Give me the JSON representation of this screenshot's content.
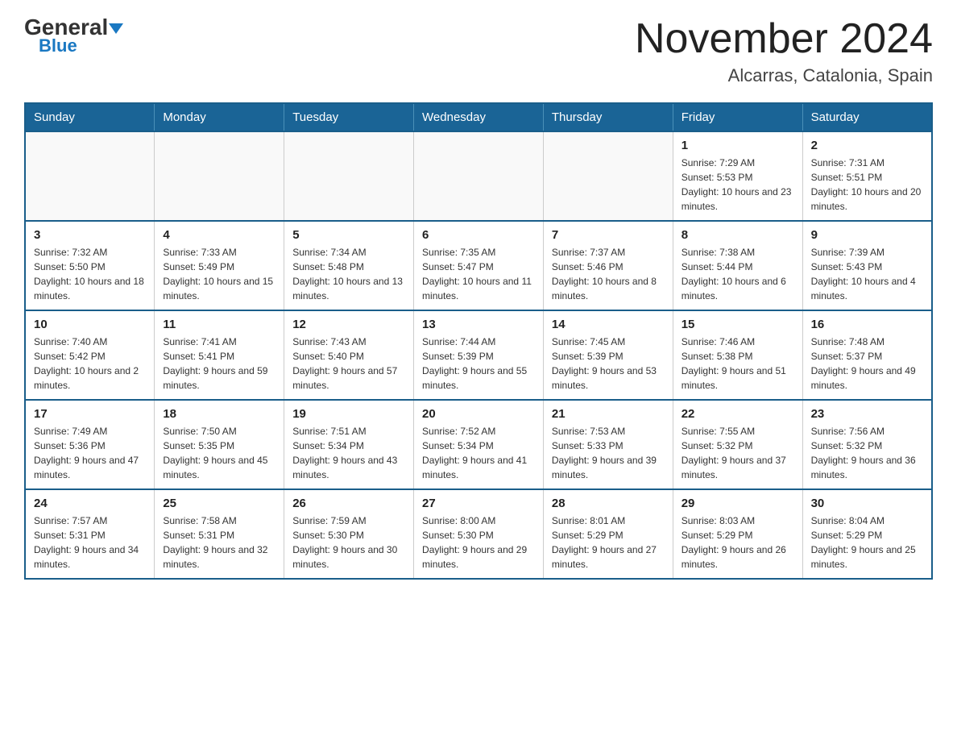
{
  "header": {
    "logo_general": "General",
    "logo_blue": "Blue",
    "month_title": "November 2024",
    "location": "Alcarras, Catalonia, Spain"
  },
  "weekdays": [
    "Sunday",
    "Monday",
    "Tuesday",
    "Wednesday",
    "Thursday",
    "Friday",
    "Saturday"
  ],
  "weeks": [
    [
      {
        "day": "",
        "sunrise": "",
        "sunset": "",
        "daylight": ""
      },
      {
        "day": "",
        "sunrise": "",
        "sunset": "",
        "daylight": ""
      },
      {
        "day": "",
        "sunrise": "",
        "sunset": "",
        "daylight": ""
      },
      {
        "day": "",
        "sunrise": "",
        "sunset": "",
        "daylight": ""
      },
      {
        "day": "",
        "sunrise": "",
        "sunset": "",
        "daylight": ""
      },
      {
        "day": "1",
        "sunrise": "Sunrise: 7:29 AM",
        "sunset": "Sunset: 5:53 PM",
        "daylight": "Daylight: 10 hours and 23 minutes."
      },
      {
        "day": "2",
        "sunrise": "Sunrise: 7:31 AM",
        "sunset": "Sunset: 5:51 PM",
        "daylight": "Daylight: 10 hours and 20 minutes."
      }
    ],
    [
      {
        "day": "3",
        "sunrise": "Sunrise: 7:32 AM",
        "sunset": "Sunset: 5:50 PM",
        "daylight": "Daylight: 10 hours and 18 minutes."
      },
      {
        "day": "4",
        "sunrise": "Sunrise: 7:33 AM",
        "sunset": "Sunset: 5:49 PM",
        "daylight": "Daylight: 10 hours and 15 minutes."
      },
      {
        "day": "5",
        "sunrise": "Sunrise: 7:34 AM",
        "sunset": "Sunset: 5:48 PM",
        "daylight": "Daylight: 10 hours and 13 minutes."
      },
      {
        "day": "6",
        "sunrise": "Sunrise: 7:35 AM",
        "sunset": "Sunset: 5:47 PM",
        "daylight": "Daylight: 10 hours and 11 minutes."
      },
      {
        "day": "7",
        "sunrise": "Sunrise: 7:37 AM",
        "sunset": "Sunset: 5:46 PM",
        "daylight": "Daylight: 10 hours and 8 minutes."
      },
      {
        "day": "8",
        "sunrise": "Sunrise: 7:38 AM",
        "sunset": "Sunset: 5:44 PM",
        "daylight": "Daylight: 10 hours and 6 minutes."
      },
      {
        "day": "9",
        "sunrise": "Sunrise: 7:39 AM",
        "sunset": "Sunset: 5:43 PM",
        "daylight": "Daylight: 10 hours and 4 minutes."
      }
    ],
    [
      {
        "day": "10",
        "sunrise": "Sunrise: 7:40 AM",
        "sunset": "Sunset: 5:42 PM",
        "daylight": "Daylight: 10 hours and 2 minutes."
      },
      {
        "day": "11",
        "sunrise": "Sunrise: 7:41 AM",
        "sunset": "Sunset: 5:41 PM",
        "daylight": "Daylight: 9 hours and 59 minutes."
      },
      {
        "day": "12",
        "sunrise": "Sunrise: 7:43 AM",
        "sunset": "Sunset: 5:40 PM",
        "daylight": "Daylight: 9 hours and 57 minutes."
      },
      {
        "day": "13",
        "sunrise": "Sunrise: 7:44 AM",
        "sunset": "Sunset: 5:39 PM",
        "daylight": "Daylight: 9 hours and 55 minutes."
      },
      {
        "day": "14",
        "sunrise": "Sunrise: 7:45 AM",
        "sunset": "Sunset: 5:39 PM",
        "daylight": "Daylight: 9 hours and 53 minutes."
      },
      {
        "day": "15",
        "sunrise": "Sunrise: 7:46 AM",
        "sunset": "Sunset: 5:38 PM",
        "daylight": "Daylight: 9 hours and 51 minutes."
      },
      {
        "day": "16",
        "sunrise": "Sunrise: 7:48 AM",
        "sunset": "Sunset: 5:37 PM",
        "daylight": "Daylight: 9 hours and 49 minutes."
      }
    ],
    [
      {
        "day": "17",
        "sunrise": "Sunrise: 7:49 AM",
        "sunset": "Sunset: 5:36 PM",
        "daylight": "Daylight: 9 hours and 47 minutes."
      },
      {
        "day": "18",
        "sunrise": "Sunrise: 7:50 AM",
        "sunset": "Sunset: 5:35 PM",
        "daylight": "Daylight: 9 hours and 45 minutes."
      },
      {
        "day": "19",
        "sunrise": "Sunrise: 7:51 AM",
        "sunset": "Sunset: 5:34 PM",
        "daylight": "Daylight: 9 hours and 43 minutes."
      },
      {
        "day": "20",
        "sunrise": "Sunrise: 7:52 AM",
        "sunset": "Sunset: 5:34 PM",
        "daylight": "Daylight: 9 hours and 41 minutes."
      },
      {
        "day": "21",
        "sunrise": "Sunrise: 7:53 AM",
        "sunset": "Sunset: 5:33 PM",
        "daylight": "Daylight: 9 hours and 39 minutes."
      },
      {
        "day": "22",
        "sunrise": "Sunrise: 7:55 AM",
        "sunset": "Sunset: 5:32 PM",
        "daylight": "Daylight: 9 hours and 37 minutes."
      },
      {
        "day": "23",
        "sunrise": "Sunrise: 7:56 AM",
        "sunset": "Sunset: 5:32 PM",
        "daylight": "Daylight: 9 hours and 36 minutes."
      }
    ],
    [
      {
        "day": "24",
        "sunrise": "Sunrise: 7:57 AM",
        "sunset": "Sunset: 5:31 PM",
        "daylight": "Daylight: 9 hours and 34 minutes."
      },
      {
        "day": "25",
        "sunrise": "Sunrise: 7:58 AM",
        "sunset": "Sunset: 5:31 PM",
        "daylight": "Daylight: 9 hours and 32 minutes."
      },
      {
        "day": "26",
        "sunrise": "Sunrise: 7:59 AM",
        "sunset": "Sunset: 5:30 PM",
        "daylight": "Daylight: 9 hours and 30 minutes."
      },
      {
        "day": "27",
        "sunrise": "Sunrise: 8:00 AM",
        "sunset": "Sunset: 5:30 PM",
        "daylight": "Daylight: 9 hours and 29 minutes."
      },
      {
        "day": "28",
        "sunrise": "Sunrise: 8:01 AM",
        "sunset": "Sunset: 5:29 PM",
        "daylight": "Daylight: 9 hours and 27 minutes."
      },
      {
        "day": "29",
        "sunrise": "Sunrise: 8:03 AM",
        "sunset": "Sunset: 5:29 PM",
        "daylight": "Daylight: 9 hours and 26 minutes."
      },
      {
        "day": "30",
        "sunrise": "Sunrise: 8:04 AM",
        "sunset": "Sunset: 5:29 PM",
        "daylight": "Daylight: 9 hours and 25 minutes."
      }
    ]
  ]
}
